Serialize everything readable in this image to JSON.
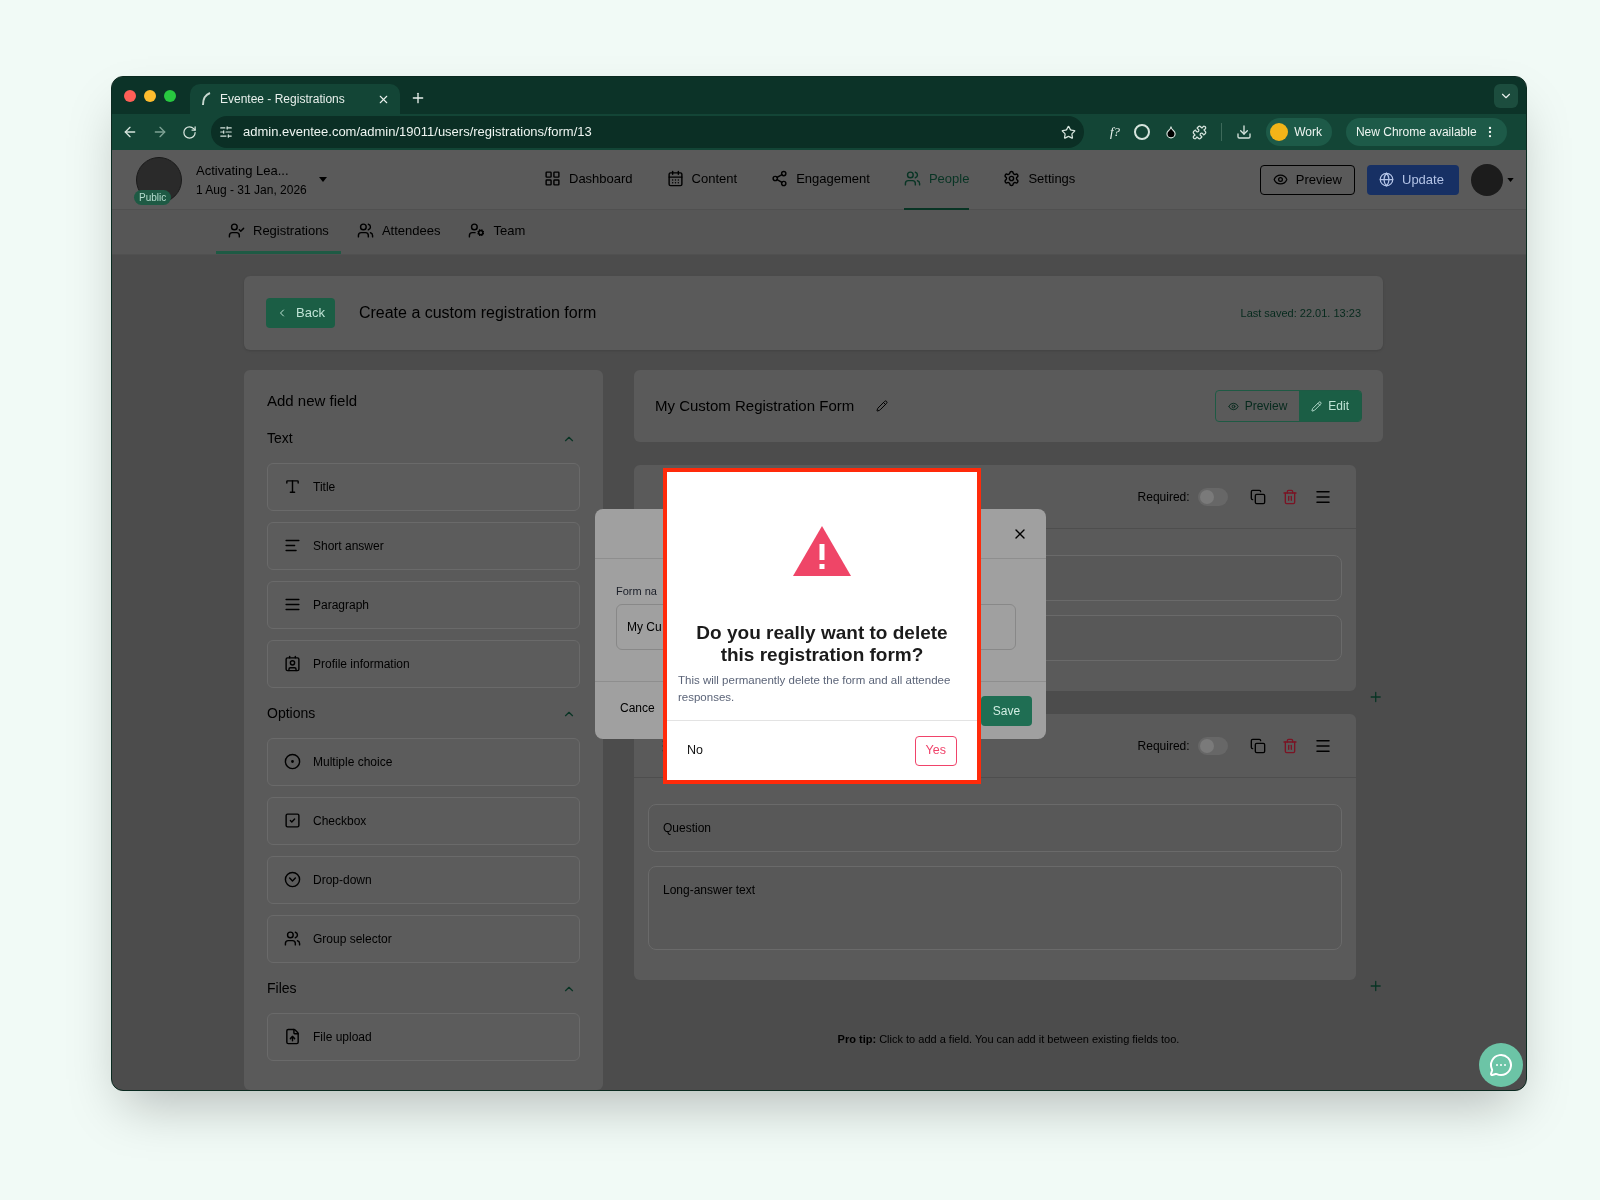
{
  "browser": {
    "tab_title": "Eventee - Registrations",
    "url": "admin.eventee.com/admin/19011/users/registrations/form/13",
    "extension_label": "f?",
    "profile": "Work",
    "update_notice": "New Chrome available"
  },
  "event": {
    "name": "Activating Lea...",
    "badge": "Public",
    "dates": "1 Aug - 31 Jan, 2026"
  },
  "nav": [
    {
      "label": "Dashboard",
      "kind": "dashboard",
      "selected": false
    },
    {
      "label": "Content",
      "kind": "content",
      "selected": false
    },
    {
      "label": "Engagement",
      "kind": "engagement",
      "selected": false
    },
    {
      "label": "People",
      "kind": "people",
      "selected": true
    },
    {
      "label": "Settings",
      "kind": "settings",
      "selected": false
    }
  ],
  "header_actions": {
    "preview": "Preview",
    "update": "Update"
  },
  "subnav": [
    {
      "label": "Registrations",
      "kind": "registrations",
      "selected": true
    },
    {
      "label": "Attendees",
      "kind": "attendees",
      "selected": false
    },
    {
      "label": "Team",
      "kind": "team",
      "selected": false
    }
  ],
  "page": {
    "back": "Back",
    "title": "Create a custom registration form",
    "last_saved": "Last saved: 22.01. 13:23"
  },
  "palette": {
    "title": "Add new field",
    "sections": [
      {
        "title": "Text",
        "expanded": true,
        "items": [
          {
            "label": "Title",
            "kind": "title"
          },
          {
            "label": "Short answer",
            "kind": "short"
          },
          {
            "label": "Paragraph",
            "kind": "paragraph"
          },
          {
            "label": "Profile information",
            "kind": "profile"
          }
        ]
      },
      {
        "title": "Options",
        "expanded": true,
        "items": [
          {
            "label": "Multiple choice",
            "kind": "radio"
          },
          {
            "label": "Checkbox",
            "kind": "checkbox"
          },
          {
            "label": "Drop-down",
            "kind": "dropdown"
          },
          {
            "label": "Group selector",
            "kind": "group"
          }
        ]
      },
      {
        "title": "Files",
        "expanded": true,
        "items": [
          {
            "label": "File upload",
            "kind": "file"
          }
        ]
      }
    ]
  },
  "form": {
    "name": "My Custom Registration Form",
    "modes": [
      {
        "label": "Preview",
        "kind": "preview",
        "selected": false
      },
      {
        "label": "Edit",
        "kind": "edit",
        "selected": true
      }
    ],
    "fields": [
      {
        "kind": "short",
        "required_label": "Required:",
        "required": false
      },
      {
        "kind": "long",
        "required_label": "Required:",
        "required": false,
        "question_placeholder": "Question",
        "answer_placeholder": "Long-answer text"
      }
    ],
    "tip": "**Pro tip:** Click to add a field. You can add it between existing fields too."
  },
  "edit_dialog": {
    "label": "Form na",
    "value": "My Cu",
    "cancel": "Cance",
    "save": "Save"
  },
  "confirm_dialog": {
    "title": "Do you really want to delete this registration form?",
    "message": "This will permanently delete the form and all attendee responses.",
    "no": "No",
    "yes": "Yes"
  }
}
